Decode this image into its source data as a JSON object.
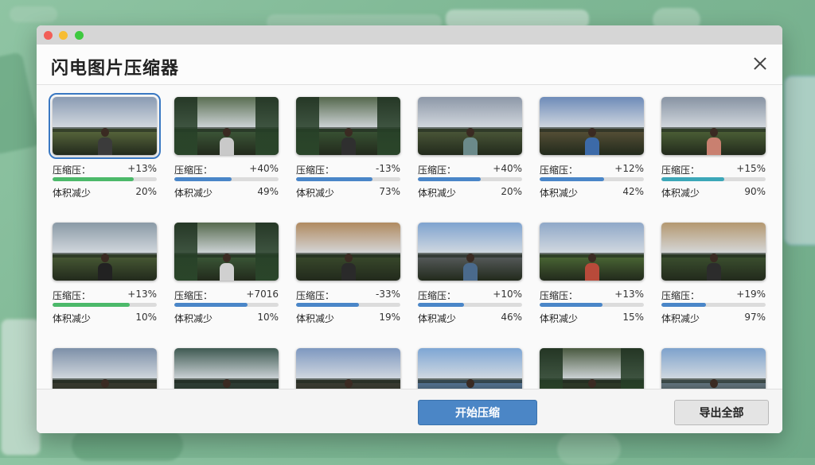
{
  "window": {
    "title": "闪电图片压缩器"
  },
  "labels": {
    "ratio": "压缩压：",
    "size": "体积减少"
  },
  "images": [
    {
      "ratio": "+13%",
      "size": "20%",
      "progress": 0.78,
      "bar_color": "#4cb96a",
      "sky": "#8a9bb3",
      "ground": "#5c6a3e",
      "shirt": "#3b3b3b",
      "selected": true
    },
    {
      "ratio": "+40%",
      "size": "49%",
      "progress": 0.55,
      "bar_color": "#4a86c8",
      "sky": "#5a6e52",
      "ground": "#3e5a3a",
      "shirt": "#c9c9c9",
      "trees": true
    },
    {
      "ratio": "-13%",
      "size": "73%",
      "progress": 0.73,
      "bar_color": "#4a86c8",
      "sky": "#55684d",
      "ground": "#3a5535",
      "shirt": "#2f2f2f",
      "trees": true
    },
    {
      "ratio": "+40%",
      "size": "20%",
      "progress": 0.6,
      "bar_color": "#4a86c8",
      "sky": "#8d98a8",
      "ground": "#4e5a3a",
      "shirt": "#6b8a8a"
    },
    {
      "ratio": "+12%",
      "size": "42%",
      "progress": 0.62,
      "bar_color": "#4a86c8",
      "sky": "#6e8bb8",
      "ground": "#5a5238",
      "shirt": "#3c6aa8"
    },
    {
      "ratio": "+15%",
      "size": "90%",
      "progress": 0.6,
      "bar_color": "#3ca7b8",
      "sky": "#8793a3",
      "ground": "#4f6438",
      "shirt": "#c98070"
    },
    {
      "ratio": "+13%",
      "size": "10%",
      "progress": 0.74,
      "bar_color": "#4cb96a",
      "sky": "#8a9aa6",
      "ground": "#4a5c36",
      "shirt": "#222222"
    },
    {
      "ratio": "+7016",
      "size": "10%",
      "progress": 0.7,
      "bar_color": "#4a86c8",
      "sky": "#566a4e",
      "ground": "#3c5a38",
      "shirt": "#d0d0d0",
      "trees": true
    },
    {
      "ratio": "-33%",
      "size": "19%",
      "progress": 0.6,
      "bar_color": "#4a86c8",
      "sky": "#b08a60",
      "ground": "#3a4a2c",
      "shirt": "#2a2a2a"
    },
    {
      "ratio": "+10%",
      "size": "46%",
      "progress": 0.44,
      "bar_color": "#4a86c8",
      "sky": "#7fa3cf",
      "ground": "#5a5e60",
      "shirt": "#4a6a8c"
    },
    {
      "ratio": "+13%",
      "size": "15%",
      "progress": 0.6,
      "bar_color": "#4a86c8",
      "sky": "#8fa8c8",
      "ground": "#4d6a36",
      "shirt": "#b84a3a"
    },
    {
      "ratio": "+19%",
      "size": "97%",
      "progress": 0.43,
      "bar_color": "#4a86c8",
      "sky": "#b49870",
      "ground": "#3d5230",
      "shirt": "#2c2c2c"
    },
    {
      "ratio": "",
      "size": "",
      "progress": 0,
      "bar_color": "#4a86c8",
      "sky": "#7d90a8",
      "ground": "#3a3a30",
      "shirt": "#2a2a2a"
    },
    {
      "ratio": "",
      "size": "",
      "progress": 0,
      "bar_color": "#4a86c8",
      "sky": "#3f5a52",
      "ground": "#2f3f38",
      "shirt": "#d8d8d8"
    },
    {
      "ratio": "",
      "size": "",
      "progress": 0,
      "bar_color": "#4a86c8",
      "sky": "#7e98c0",
      "ground": "#3c3c34",
      "shirt": "#e6e6e6"
    },
    {
      "ratio": "",
      "size": "",
      "progress": 0,
      "bar_color": "#4a86c8",
      "sky": "#7ea6d4",
      "ground": "#5a7aa0",
      "shirt": "#2a3a5a"
    },
    {
      "ratio": "",
      "size": "",
      "progress": 0,
      "bar_color": "#4a86c8",
      "sky": "#4a5a40",
      "ground": "#2e3a28",
      "shirt": "#3a2a22",
      "trees": true
    },
    {
      "ratio": "",
      "size": "",
      "progress": 0,
      "bar_color": "#4a86c8",
      "sky": "#7ea2cc",
      "ground": "#6a7c8a",
      "shirt": "#2a2a2a"
    }
  ],
  "footer": {
    "start_label": "开始压缩",
    "export_label": "导出全部"
  },
  "colors": {
    "accent": "#4b86c6",
    "bar_bg": "#dcdcdc"
  }
}
